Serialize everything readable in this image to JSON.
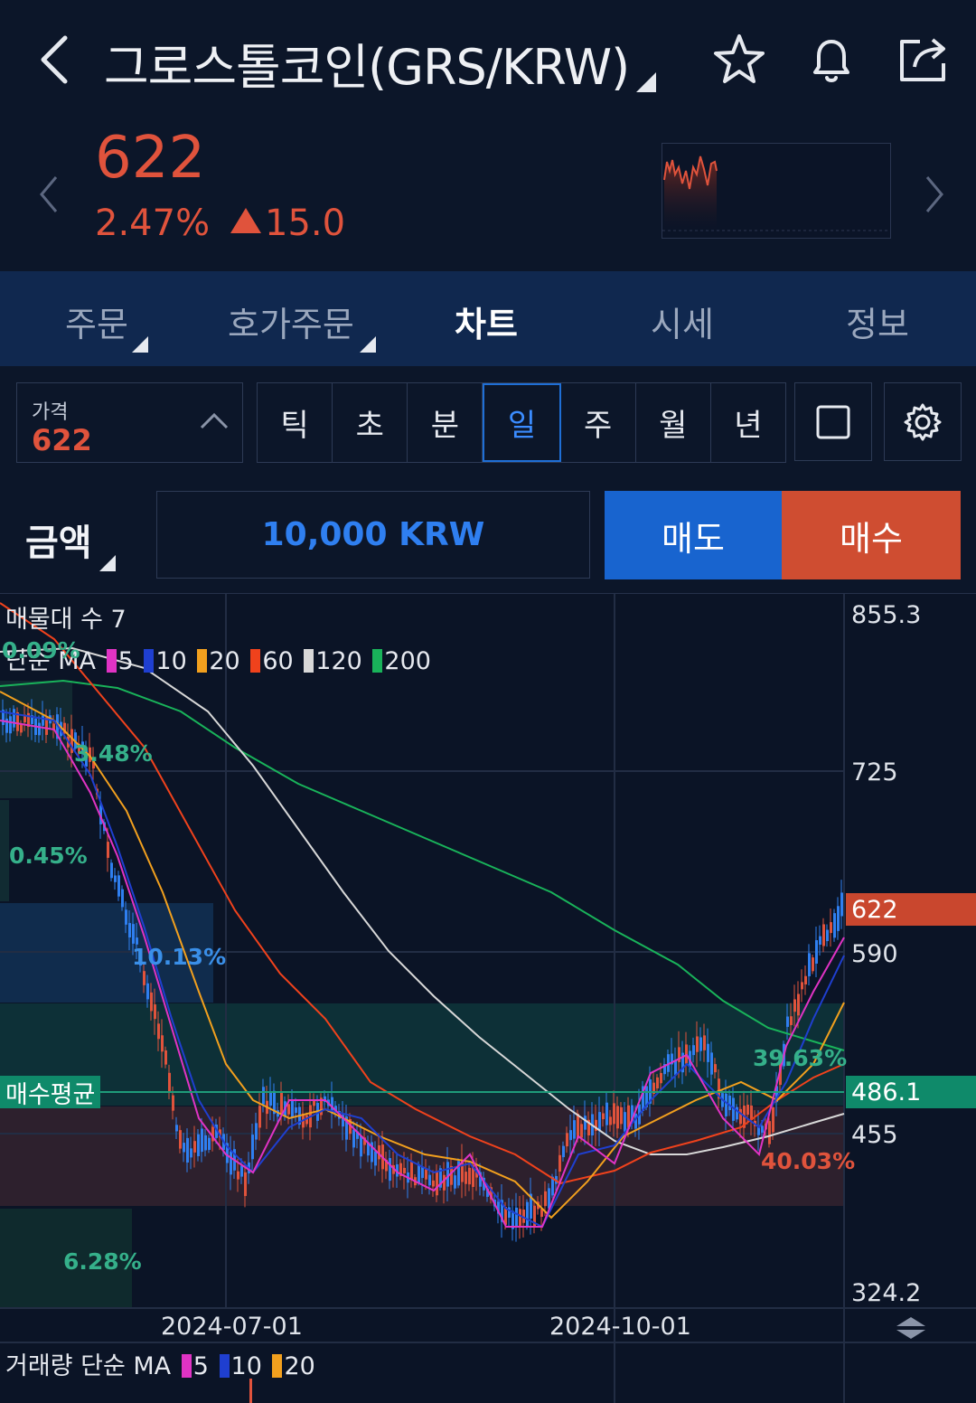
{
  "header": {
    "title": "그로스톨코인(GRS/KRW)",
    "price": "622",
    "change_pct": "2.47%",
    "change_abs": "15.0"
  },
  "tabs": [
    {
      "label": "주문"
    },
    {
      "label": "호가주문"
    },
    {
      "label": "차트"
    },
    {
      "label": "시세"
    },
    {
      "label": "정보"
    }
  ],
  "controls": {
    "price_label": "가격",
    "price_value": "622",
    "periods": [
      "틱",
      "초",
      "분",
      "일",
      "주",
      "월",
      "년"
    ],
    "selected_period": "일"
  },
  "order": {
    "amount_label": "금액",
    "amount_value": "10,000 KRW",
    "sell_label": "매도",
    "buy_label": "매수"
  },
  "chart": {
    "volume_profile_label": "매물대 수 7",
    "ma_label": "단순 MA",
    "ma_periods": [
      "5",
      "10",
      "20",
      "60",
      "120",
      "200"
    ],
    "ma_colors": [
      "#e033c4",
      "#1f3fd0",
      "#f2a01e",
      "#f0421c",
      "#d8d8d8",
      "#19b35a"
    ],
    "y_ticks": [
      "855.3",
      "725",
      "590",
      "455",
      "324.2"
    ],
    "current_price_tag": "622",
    "avg_buy_label": "매수평균",
    "avg_buy_value": "486.1",
    "x_ticks": [
      "2024-07-01",
      "2024-10-01"
    ],
    "volume_profile_pcts": [
      "0.09%",
      "3.48%",
      "0.45%",
      "10.13%",
      "39.63%",
      "40.03%",
      "6.28%"
    ],
    "volume_ma_label": "거래량 단순 MA",
    "volume_ma_periods": [
      "5",
      "10",
      "20"
    ]
  },
  "colors": {
    "up": "#e0533c",
    "down": "#2f7ff0",
    "accent": "#1f6fd6",
    "avg_buy": "#0f8a6a"
  }
}
